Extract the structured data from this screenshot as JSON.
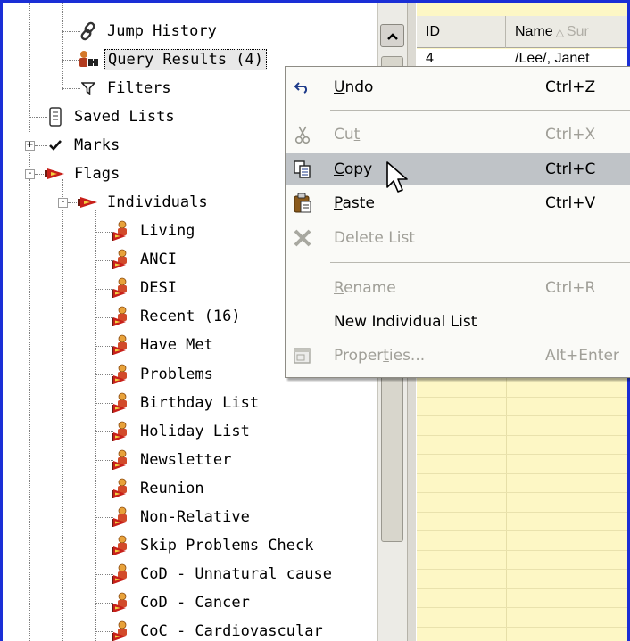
{
  "tree": {
    "nodes": [
      {
        "label": "Jump History",
        "icon": "chain-link-icon"
      },
      {
        "label": "Query Results (4)",
        "icon": "binoculars-icon",
        "selected": true
      },
      {
        "label": "Filters",
        "icon": "funnel-icon"
      },
      {
        "label": "Saved Lists",
        "icon": "scroll-icon"
      },
      {
        "label": "Marks",
        "icon": "checkmark-icon",
        "expander": "+"
      },
      {
        "label": "Flags",
        "icon": "flag-icon",
        "expander": "-"
      },
      {
        "label": "Individuals",
        "icon": "flag-icon",
        "expander": "-"
      },
      {
        "label": "Living",
        "icon": "person-flag-icon"
      },
      {
        "label": "ANCI",
        "icon": "person-flag-icon"
      },
      {
        "label": "DESI",
        "icon": "person-flag-icon"
      },
      {
        "label": "Recent (16)",
        "icon": "person-flag-icon"
      },
      {
        "label": "Have Met",
        "icon": "person-flag-icon"
      },
      {
        "label": "Problems",
        "icon": "person-flag-icon"
      },
      {
        "label": "Birthday List",
        "icon": "person-flag-icon"
      },
      {
        "label": "Holiday List",
        "icon": "person-flag-icon"
      },
      {
        "label": "Newsletter",
        "icon": "person-flag-icon"
      },
      {
        "label": "Reunion",
        "icon": "person-flag-icon"
      },
      {
        "label": "Non-Relative",
        "icon": "person-flag-icon"
      },
      {
        "label": "Skip Problems Check",
        "icon": "person-flag-icon"
      },
      {
        "label": "CoD - Unnatural cause",
        "icon": "person-flag-icon"
      },
      {
        "label": "CoD - Cancer",
        "icon": "person-flag-icon"
      },
      {
        "label": "CoC - Cardiovascular",
        "icon": "person-flag-icon"
      }
    ]
  },
  "grid": {
    "columns": [
      {
        "label": "ID"
      },
      {
        "label": "Name",
        "sort_indicator": "△",
        "extra": "Sur"
      }
    ],
    "rows": [
      {
        "id": "4",
        "name": "/Lee/, Janet"
      }
    ]
  },
  "context_menu": {
    "items": [
      {
        "pre": "",
        "accel": "U",
        "post": "ndo",
        "shortcut": "Ctrl+Z",
        "icon": "undo-arrow-icon",
        "enabled": true
      },
      {
        "pre": "Cu",
        "accel": "t",
        "post": "",
        "shortcut": "Ctrl+X",
        "icon": "scissors-icon",
        "enabled": false
      },
      {
        "pre": "",
        "accel": "C",
        "post": "opy",
        "shortcut": "Ctrl+C",
        "icon": "copy-icon",
        "enabled": true,
        "highlighted": true
      },
      {
        "pre": "",
        "accel": "P",
        "post": "aste",
        "shortcut": "Ctrl+V",
        "icon": "clipboard-icon",
        "enabled": true
      },
      {
        "pre": "Delete List",
        "accel": "",
        "post": "",
        "shortcut": "",
        "icon": "delete-x-icon",
        "enabled": false
      },
      {
        "pre": "",
        "accel": "R",
        "post": "ename",
        "shortcut": "Ctrl+R",
        "icon": "",
        "enabled": false
      },
      {
        "pre": "New Individual List",
        "accel": "",
        "post": "",
        "shortcut": "",
        "icon": "",
        "enabled": true
      },
      {
        "pre": "Proper",
        "accel": "t",
        "post": "ies...",
        "shortcut": "Alt+Enter",
        "icon": "properties-icon",
        "enabled": false
      }
    ]
  },
  "colors": {
    "frame": "#1a2ed6",
    "grid_background": "#fdf7c5",
    "menu_highlight": "#bfc3c7",
    "disabled_text": "#a09f98",
    "flag_red": "#c8201a"
  }
}
